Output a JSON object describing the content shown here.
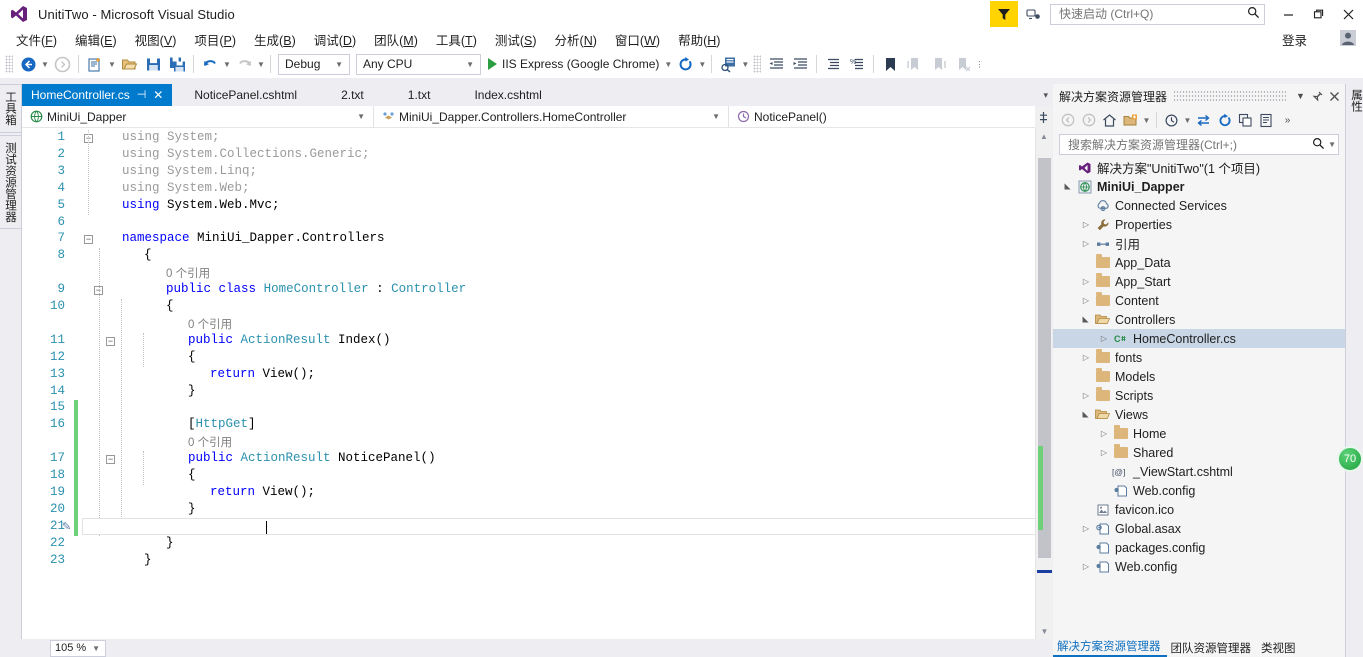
{
  "window": {
    "title": "UnitiTwo - Microsoft Visual Studio",
    "logo_icon": "visual-studio-logo",
    "minimize_icon": "minimize-icon",
    "maximize_icon": "maximize-icon",
    "close_icon": "close-icon",
    "feedback_icon": "feedback-funnel-icon",
    "notify_icon": "notifications-icon",
    "signin_label": "登录",
    "avatar_icon": "user-avatar-icon"
  },
  "quick_launch": {
    "placeholder": "快速启动 (Ctrl+Q)",
    "value": "",
    "icon": "search-icon"
  },
  "menubar": {
    "items": [
      {
        "label": "文件",
        "key": "F"
      },
      {
        "label": "编辑",
        "key": "E"
      },
      {
        "label": "视图",
        "key": "V"
      },
      {
        "label": "项目",
        "key": "P"
      },
      {
        "label": "生成",
        "key": "B"
      },
      {
        "label": "调试",
        "key": "D"
      },
      {
        "label": "团队",
        "key": "M"
      },
      {
        "label": "工具",
        "key": "T"
      },
      {
        "label": "测试",
        "key": "S"
      },
      {
        "label": "分析",
        "key": "N"
      },
      {
        "label": "窗口",
        "key": "W"
      },
      {
        "label": "帮助",
        "key": "H"
      }
    ]
  },
  "toolbar": {
    "config_value": "Debug",
    "platform_value": "Any CPU",
    "run_label": "IIS Express (Google Chrome)",
    "icons": [
      "navigate-back-icon",
      "navigate-forward-icon",
      "new-project-icon",
      "open-file-icon",
      "save-icon",
      "save-all-icon",
      "undo-icon",
      "redo-icon",
      "start-debug-icon",
      "refresh-icon",
      "find-in-files-icon",
      "outdent-icon",
      "indent-icon",
      "comment-icon",
      "uncomment-icon",
      "bookmark-icon",
      "prev-bookmark-icon",
      "next-bookmark-icon",
      "clear-bookmarks-icon"
    ]
  },
  "left_vertical_tabs": [
    {
      "label": "工具箱"
    },
    {
      "label": "测试资源管理器"
    }
  ],
  "right_vertical_tabs": [
    {
      "label": "属性"
    }
  ],
  "editor": {
    "tabs": [
      {
        "label": "HomeController.cs",
        "active": true,
        "pin_icon": "pin-icon",
        "close_icon": "close-icon"
      },
      {
        "label": "NoticePanel.cshtml",
        "active": false
      },
      {
        "label": "2.txt",
        "active": false
      },
      {
        "label": "1.txt",
        "active": false
      },
      {
        "label": "Index.cshtml",
        "active": false
      }
    ],
    "nav_project": "MiniUi_Dapper",
    "nav_project_icon": "project-icon",
    "nav_type": "MiniUi_Dapper.Controllers.HomeController",
    "nav_type_icon": "class-icon",
    "nav_member": "NoticePanel()",
    "nav_member_icon": "method-icon",
    "zoom_level": "105 %",
    "split_icon": "split-view-icon",
    "current_line": 21,
    "code_lines": [
      {
        "n": 1,
        "indent": 0,
        "fold": "minus",
        "tokens": [
          [
            "kw gray",
            "using"
          ],
          [
            "gray",
            " System;"
          ]
        ]
      },
      {
        "n": 2,
        "indent": 0,
        "tokens": [
          [
            "kw gray",
            "using"
          ],
          [
            "gray",
            " System.Collections.Generic;"
          ]
        ]
      },
      {
        "n": 3,
        "indent": 0,
        "tokens": [
          [
            "kw gray",
            "using"
          ],
          [
            "gray",
            " System.Linq;"
          ]
        ]
      },
      {
        "n": 4,
        "indent": 0,
        "tokens": [
          [
            "kw gray",
            "using"
          ],
          [
            "gray",
            " System.Web;"
          ]
        ]
      },
      {
        "n": 5,
        "indent": 0,
        "tokens": [
          [
            "kw",
            "using"
          ],
          [
            "pln",
            " System.Web.Mvc;"
          ]
        ]
      },
      {
        "n": 6,
        "indent": 0,
        "tokens": []
      },
      {
        "n": 7,
        "indent": 0,
        "fold": "minus",
        "tokens": [
          [
            "kw",
            "namespace"
          ],
          [
            "pln",
            " MiniUi_Dapper.Controllers"
          ]
        ]
      },
      {
        "n": 8,
        "indent": 1,
        "tokens": [
          [
            "pln",
            "{"
          ]
        ]
      },
      {
        "n": null,
        "indent": 2,
        "lens": "0 个引用"
      },
      {
        "n": 9,
        "indent": 2,
        "fold": "minus",
        "tokens": [
          [
            "kw",
            "public"
          ],
          [
            "pln",
            " "
          ],
          [
            "kw",
            "class"
          ],
          [
            "pln",
            " "
          ],
          [
            "ty",
            "HomeController"
          ],
          [
            "pln",
            " : "
          ],
          [
            "ty",
            "Controller"
          ]
        ]
      },
      {
        "n": 10,
        "indent": 2,
        "tokens": [
          [
            "pln",
            "{"
          ]
        ]
      },
      {
        "n": null,
        "indent": 3,
        "lens": "0 个引用"
      },
      {
        "n": 11,
        "indent": 3,
        "fold": "minus",
        "tokens": [
          [
            "kw",
            "public"
          ],
          [
            "pln",
            " "
          ],
          [
            "ty",
            "ActionResult"
          ],
          [
            "pln",
            " Index()"
          ]
        ]
      },
      {
        "n": 12,
        "indent": 3,
        "tokens": [
          [
            "pln",
            "{"
          ]
        ]
      },
      {
        "n": 13,
        "indent": 4,
        "tokens": [
          [
            "kw",
            "return"
          ],
          [
            "pln",
            " View();"
          ]
        ]
      },
      {
        "n": 14,
        "indent": 3,
        "tokens": [
          [
            "pln",
            "}"
          ]
        ]
      },
      {
        "n": 15,
        "indent": 3,
        "tokens": []
      },
      {
        "n": 16,
        "indent": 3,
        "tokens": [
          [
            "pln",
            "["
          ],
          [
            "attr",
            "HttpGet"
          ],
          [
            "pln",
            "]"
          ]
        ]
      },
      {
        "n": null,
        "indent": 3,
        "lens": "0 个引用"
      },
      {
        "n": 17,
        "indent": 3,
        "fold": "minus",
        "tokens": [
          [
            "kw",
            "public"
          ],
          [
            "pln",
            " "
          ],
          [
            "ty",
            "ActionResult"
          ],
          [
            "pln",
            " NoticePanel()"
          ]
        ]
      },
      {
        "n": 18,
        "indent": 3,
        "tokens": [
          [
            "pln",
            "{"
          ]
        ]
      },
      {
        "n": 19,
        "indent": 4,
        "tokens": [
          [
            "kw",
            "return"
          ],
          [
            "pln",
            " View();"
          ]
        ]
      },
      {
        "n": 20,
        "indent": 3,
        "tokens": [
          [
            "pln",
            "}"
          ]
        ]
      },
      {
        "n": 21,
        "indent": 3,
        "tokens": []
      },
      {
        "n": 22,
        "indent": 2,
        "tokens": [
          [
            "pln",
            "}"
          ]
        ]
      },
      {
        "n": 23,
        "indent": 1,
        "tokens": [
          [
            "pln",
            "}"
          ]
        ]
      }
    ]
  },
  "solution_explorer": {
    "title": "解决方案资源管理器",
    "header_icons": [
      "chevron-down-icon",
      "pin-icon",
      "close-icon"
    ],
    "toolbar_icons": [
      "back-icon",
      "forward-icon",
      "home-icon",
      "show-all-files-icon",
      "chevron-down-icon",
      "pending-changes-icon",
      "sync-with-active-document-icon",
      "refresh-icon",
      "collapse-all-icon",
      "properties-icon",
      "overflow-icon"
    ],
    "search": {
      "placeholder": "搜索解决方案资源管理器(Ctrl+;)",
      "value": "",
      "icon": "search-icon"
    },
    "tree": [
      {
        "depth": 0,
        "label": "解决方案\"UnitiTwo\"(1 个项目)",
        "icon": "solution-icon",
        "twist": "",
        "bold": false
      },
      {
        "depth": 0,
        "label": "MiniUi_Dapper",
        "icon": "web-project-icon",
        "twist": "down",
        "bold": true
      },
      {
        "depth": 1,
        "label": "Connected Services",
        "icon": "connected-services-icon",
        "twist": ""
      },
      {
        "depth": 1,
        "label": "Properties",
        "icon": "properties-wrench-icon",
        "twist": "right"
      },
      {
        "depth": 1,
        "label": "引用",
        "icon": "references-icon",
        "twist": "right"
      },
      {
        "depth": 1,
        "label": "App_Data",
        "icon": "folder-icon",
        "twist": ""
      },
      {
        "depth": 1,
        "label": "App_Start",
        "icon": "folder-icon",
        "twist": "right"
      },
      {
        "depth": 1,
        "label": "Content",
        "icon": "folder-icon",
        "twist": "right"
      },
      {
        "depth": 1,
        "label": "Controllers",
        "icon": "folder-open-icon",
        "twist": "down"
      },
      {
        "depth": 2,
        "label": "HomeController.cs",
        "icon": "csharp-file-icon",
        "twist": "right",
        "selected": true
      },
      {
        "depth": 1,
        "label": "fonts",
        "icon": "folder-icon",
        "twist": "right"
      },
      {
        "depth": 1,
        "label": "Models",
        "icon": "folder-icon",
        "twist": ""
      },
      {
        "depth": 1,
        "label": "Scripts",
        "icon": "folder-icon",
        "twist": "right"
      },
      {
        "depth": 1,
        "label": "Views",
        "icon": "folder-open-icon",
        "twist": "down"
      },
      {
        "depth": 2,
        "label": "Home",
        "icon": "folder-icon",
        "twist": "right"
      },
      {
        "depth": 2,
        "label": "Shared",
        "icon": "folder-icon",
        "twist": "right"
      },
      {
        "depth": 2,
        "label": "_ViewStart.cshtml",
        "icon": "razor-file-icon",
        "twist": ""
      },
      {
        "depth": 2,
        "label": "Web.config",
        "icon": "config-file-icon",
        "twist": ""
      },
      {
        "depth": 1,
        "label": "favicon.ico",
        "icon": "image-file-icon",
        "twist": ""
      },
      {
        "depth": 1,
        "label": "Global.asax",
        "icon": "global-asax-icon",
        "twist": "right"
      },
      {
        "depth": 1,
        "label": "packages.config",
        "icon": "config-file-icon",
        "twist": ""
      },
      {
        "depth": 1,
        "label": "Web.config",
        "icon": "config-file-icon",
        "twist": "right"
      }
    ],
    "bottom_tabs": [
      {
        "label": "解决方案资源管理器",
        "active": true
      },
      {
        "label": "团队资源管理器",
        "active": false
      },
      {
        "label": "类视图",
        "active": false
      }
    ]
  },
  "overlay_badge": {
    "label": "70"
  },
  "colors": {
    "accent": "#007acc",
    "titlebar_bg": "#ffffff",
    "chrome_bg": "#eeeef2",
    "editor_bg": "#ffffff",
    "keyword": "#0000ff",
    "type": "#2b91af",
    "grayed_using": "#9a9a9a",
    "changed_line_marker": "#6fd07a",
    "selection_bg": "#c9d6e5",
    "feedback_yellow": "#ffd400"
  }
}
